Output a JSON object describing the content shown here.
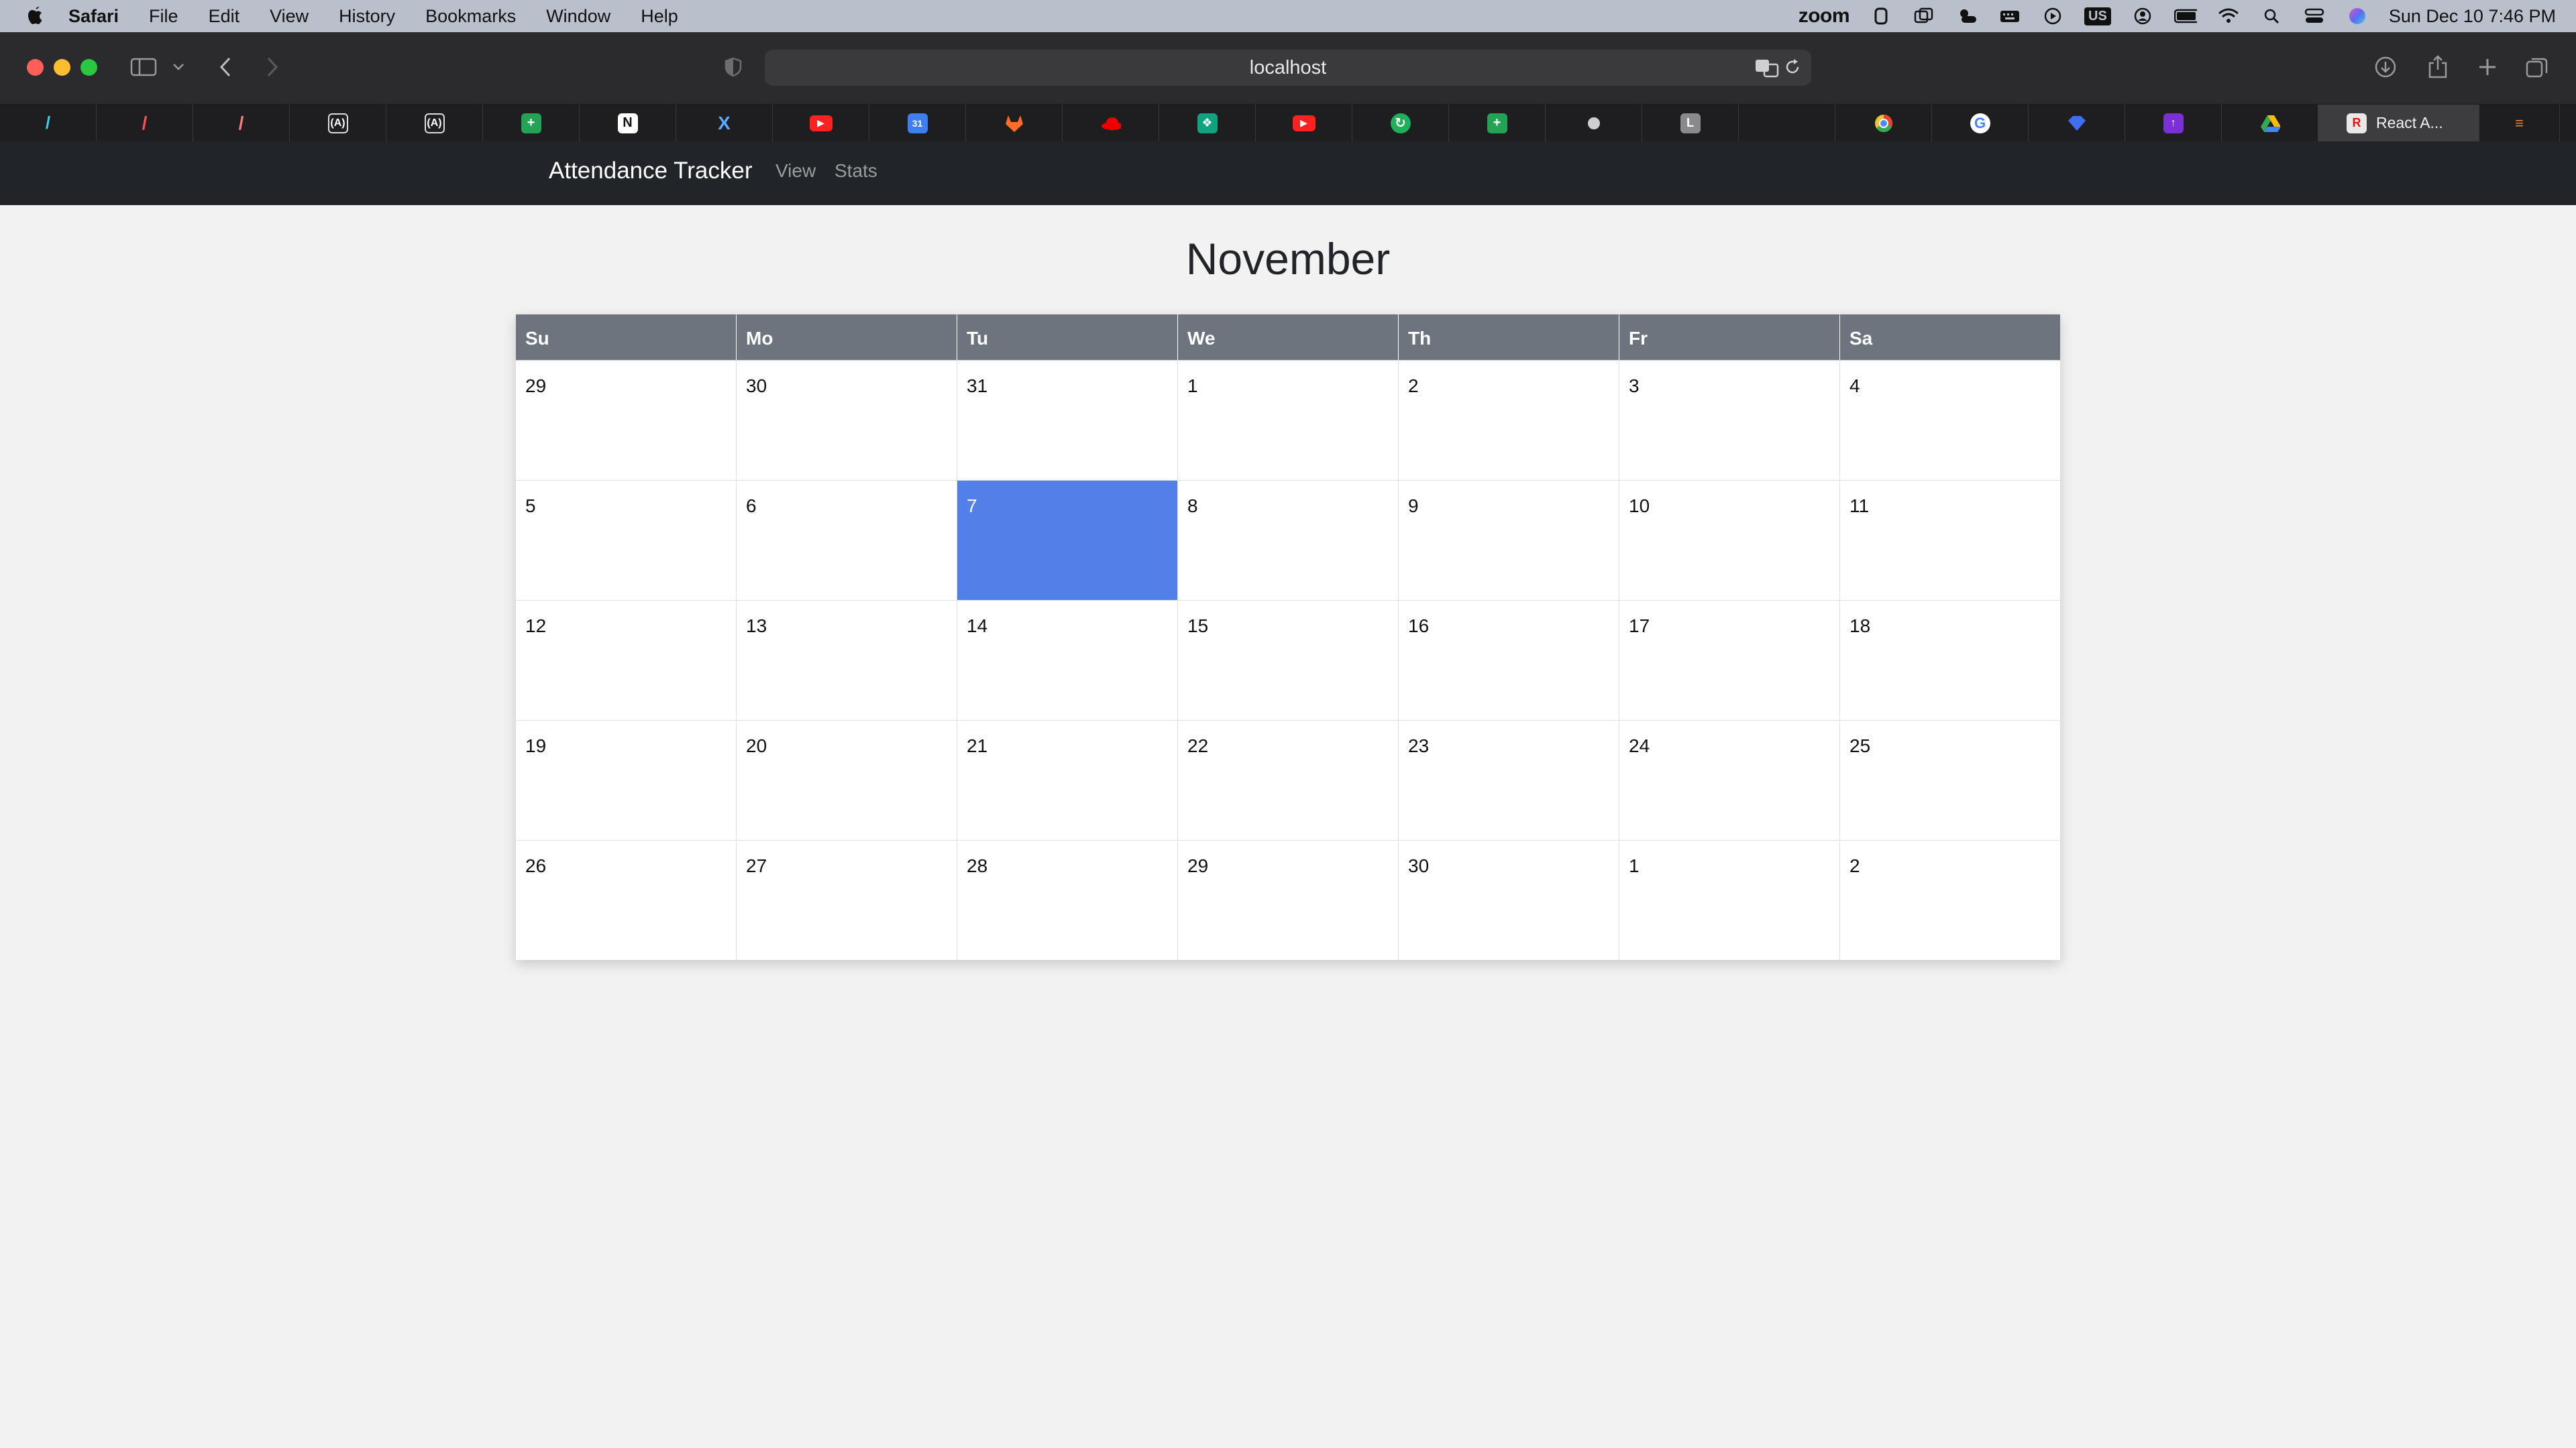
{
  "menubar": {
    "app": "Safari",
    "items": [
      "File",
      "Edit",
      "View",
      "History",
      "Bookmarks",
      "Window",
      "Help"
    ],
    "zoom": "zoom",
    "input_source": "US",
    "clock": "Sun Dec 10  7:46 PM"
  },
  "browser": {
    "url": "localhost",
    "active_tab_label": "React A..."
  },
  "navbar": {
    "brand": "Attendance Tracker",
    "links": [
      "View",
      "Stats"
    ]
  },
  "calendar": {
    "month": "November",
    "weekdays": [
      "Su",
      "Mo",
      "Tu",
      "We",
      "Th",
      "Fr",
      "Sa"
    ],
    "weeks": [
      [
        "29",
        "30",
        "31",
        "1",
        "2",
        "3",
        "4"
      ],
      [
        "5",
        "6",
        "7",
        "8",
        "9",
        "10",
        "11"
      ],
      [
        "12",
        "13",
        "14",
        "15",
        "16",
        "17",
        "18"
      ],
      [
        "19",
        "20",
        "21",
        "22",
        "23",
        "24",
        "25"
      ],
      [
        "26",
        "27",
        "28",
        "29",
        "30",
        "1",
        "2"
      ]
    ],
    "selected_day": "7",
    "selected_color": "#5180e9"
  }
}
